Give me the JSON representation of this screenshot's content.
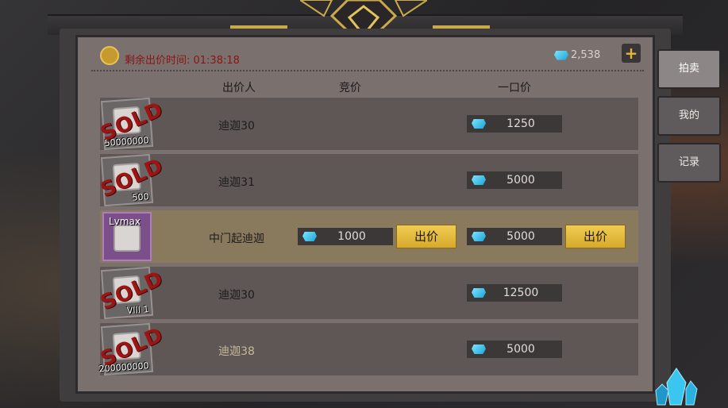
{
  "header": {
    "timer_label": "剩余出价时间: 01:38:18",
    "balance": "2,538",
    "add_label": "+"
  },
  "columns": {
    "bidder": "出价人",
    "bid": "竞价",
    "buyout": "一口价"
  },
  "side_tabs": [
    {
      "label": "拍卖",
      "active": true
    },
    {
      "label": "我的",
      "active": false
    },
    {
      "label": "记录",
      "active": false
    }
  ],
  "rows": [
    {
      "bidder": "迪迦30",
      "count": "50000000",
      "sold": "SOLD",
      "buyout": "1250"
    },
    {
      "bidder": "迪迦31",
      "count": "500",
      "sold": "SOLD",
      "buyout": "5000"
    },
    {
      "bidder": "中门起迪迦",
      "level": "Lvmax",
      "bid": "1000",
      "bid_button": "出价",
      "buyout": "5000",
      "buyout_button": "出价"
    },
    {
      "bidder": "迪迦30",
      "count": "VIII 1",
      "sold": "SOLD",
      "buyout": "12500"
    },
    {
      "bidder": "迪迦38",
      "count": "200000000",
      "sold": "SOLD",
      "buyout": "5000"
    }
  ],
  "colors": {
    "accent_gold": "#e6b734",
    "timer_red": "#8b1414",
    "gem_blue": "#1aa3d6"
  }
}
